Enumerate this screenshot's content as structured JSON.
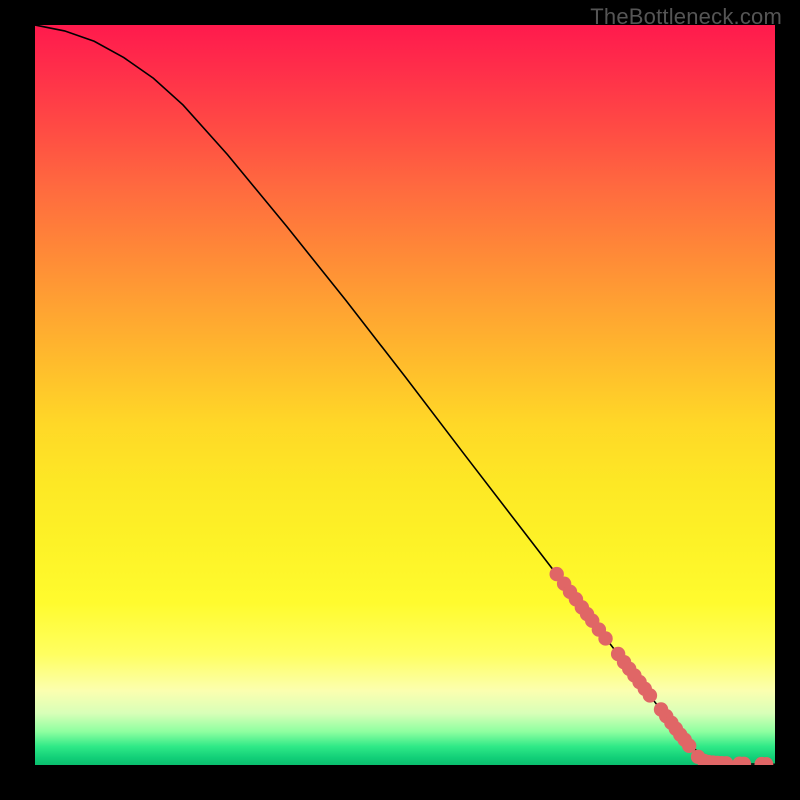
{
  "watermark": "TheBottleneck.com",
  "chart_data": {
    "type": "line",
    "title": "",
    "xlabel": "",
    "ylabel": "",
    "xlim": [
      0,
      100
    ],
    "ylim": [
      0,
      100
    ],
    "curve": [
      {
        "x": 0,
        "y": 100
      },
      {
        "x": 4,
        "y": 99.2
      },
      {
        "x": 8,
        "y": 97.8
      },
      {
        "x": 12,
        "y": 95.6
      },
      {
        "x": 16,
        "y": 92.8
      },
      {
        "x": 20,
        "y": 89.2
      },
      {
        "x": 26,
        "y": 82.5
      },
      {
        "x": 34,
        "y": 72.8
      },
      {
        "x": 42,
        "y": 62.8
      },
      {
        "x": 50,
        "y": 52.5
      },
      {
        "x": 58,
        "y": 42.0
      },
      {
        "x": 66,
        "y": 31.6
      },
      {
        "x": 72,
        "y": 23.8
      },
      {
        "x": 78,
        "y": 16.0
      },
      {
        "x": 84,
        "y": 8.2
      },
      {
        "x": 88,
        "y": 3.2
      },
      {
        "x": 90,
        "y": 1.4
      },
      {
        "x": 92,
        "y": 0.5
      },
      {
        "x": 96,
        "y": 0.15
      },
      {
        "x": 100,
        "y": 0.1
      }
    ],
    "series": [
      {
        "name": "markers",
        "color": "#e06666",
        "points": [
          {
            "x": 70.5,
            "y": 25.8
          },
          {
            "x": 71.5,
            "y": 24.5
          },
          {
            "x": 72.3,
            "y": 23.4
          },
          {
            "x": 73.1,
            "y": 22.4
          },
          {
            "x": 73.9,
            "y": 21.3
          },
          {
            "x": 74.6,
            "y": 20.4
          },
          {
            "x": 75.3,
            "y": 19.5
          },
          {
            "x": 76.2,
            "y": 18.3
          },
          {
            "x": 77.1,
            "y": 17.1
          },
          {
            "x": 78.8,
            "y": 15.0
          },
          {
            "x": 79.6,
            "y": 13.9
          },
          {
            "x": 80.3,
            "y": 13.0
          },
          {
            "x": 81.0,
            "y": 12.1
          },
          {
            "x": 81.7,
            "y": 11.2
          },
          {
            "x": 82.4,
            "y": 10.3
          },
          {
            "x": 83.1,
            "y": 9.4
          },
          {
            "x": 84.6,
            "y": 7.5
          },
          {
            "x": 85.3,
            "y": 6.6
          },
          {
            "x": 86.0,
            "y": 5.7
          },
          {
            "x": 86.6,
            "y": 4.9
          },
          {
            "x": 87.2,
            "y": 4.1
          },
          {
            "x": 87.8,
            "y": 3.4
          },
          {
            "x": 88.4,
            "y": 2.6
          },
          {
            "x": 89.6,
            "y": 1.1
          },
          {
            "x": 90.4,
            "y": 0.55
          },
          {
            "x": 91.0,
            "y": 0.4
          },
          {
            "x": 91.6,
            "y": 0.32
          },
          {
            "x": 92.2,
            "y": 0.27
          },
          {
            "x": 92.8,
            "y": 0.24
          },
          {
            "x": 93.4,
            "y": 0.22
          },
          {
            "x": 95.2,
            "y": 0.17
          },
          {
            "x": 95.8,
            "y": 0.16
          },
          {
            "x": 98.2,
            "y": 0.12
          },
          {
            "x": 98.8,
            "y": 0.11
          }
        ]
      }
    ]
  }
}
